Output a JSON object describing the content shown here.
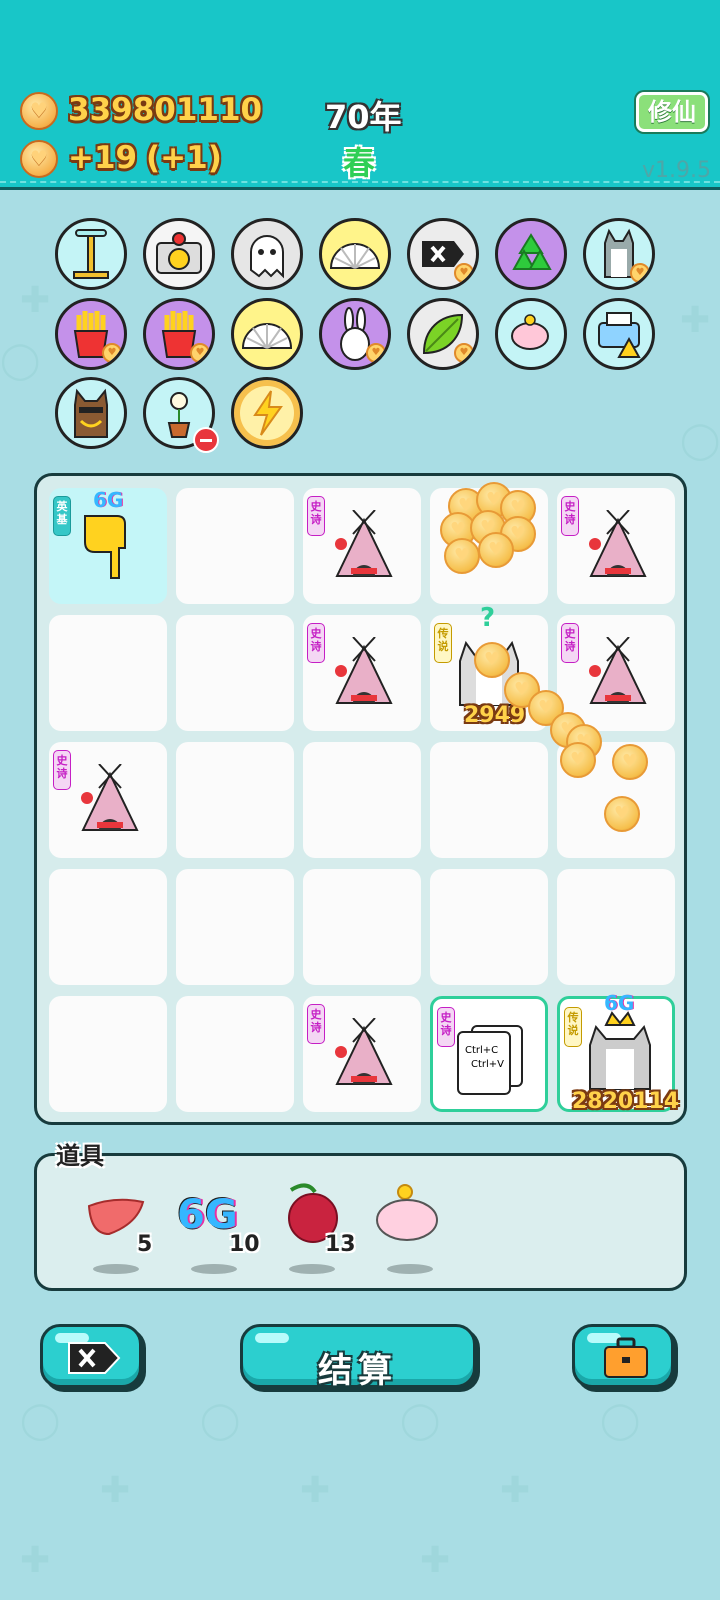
{
  "header": {
    "coins": "339801110",
    "income": "+19",
    "income_bonus": "(+1)",
    "year": "70年",
    "season": "春",
    "cultivate_button": "修仙",
    "version": "v1.9.5"
  },
  "buffs": [
    {
      "icon": "pump-icon"
    },
    {
      "icon": "pot-duck-icon"
    },
    {
      "icon": "ghost-icon"
    },
    {
      "icon": "shell-icon"
    },
    {
      "icon": "delete-tag-icon"
    },
    {
      "icon": "recycle-icon"
    },
    {
      "icon": "husky-icon"
    },
    {
      "icon": "fries-icon"
    },
    {
      "icon": "fries-icon"
    },
    {
      "icon": "shell-icon"
    },
    {
      "icon": "rabbit-icon"
    },
    {
      "icon": "leaf-icon"
    },
    {
      "icon": "piggy-bank-icon"
    },
    {
      "icon": "printer-icon"
    },
    {
      "icon": "dog-gold-chain-icon"
    },
    {
      "icon": "flower-pot-icon"
    },
    {
      "icon": "lightning-icon"
    }
  ],
  "board": {
    "tags": {
      "shi": "史诗",
      "chuan": "传说",
      "ying": "英基"
    },
    "hand_label": "6G",
    "husky_label": "6G",
    "question": "?",
    "cell_value_1": "2949",
    "cell_value_2": "2820114",
    "copy_paste": {
      "line1": "Ctrl+C",
      "line2": "Ctrl+V"
    }
  },
  "items": {
    "title": "道具",
    "list": [
      {
        "icon": "liver-icon",
        "count": "5"
      },
      {
        "icon": "6g-icon",
        "label": "6G",
        "count": "10"
      },
      {
        "icon": "lychee-icon",
        "count": "13"
      },
      {
        "icon": "piggy-bank-icon",
        "count": ""
      }
    ]
  },
  "buttons": {
    "settle": "结算"
  }
}
